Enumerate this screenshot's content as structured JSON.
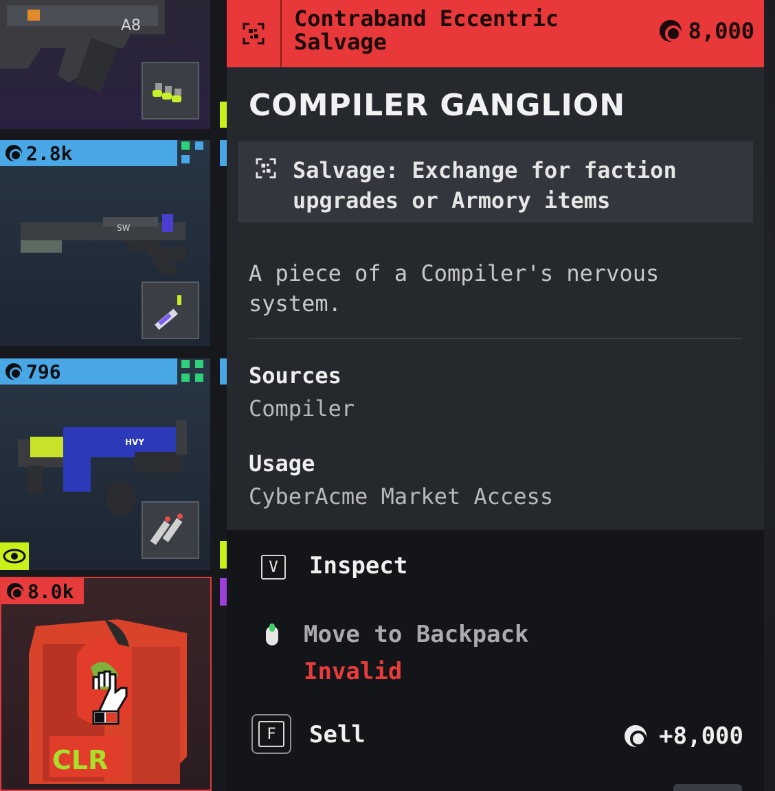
{
  "inventory": {
    "slots": [
      {
        "price": "",
        "accent": "#c9f01a"
      },
      {
        "price": "2.8k",
        "accent": "#49a7e6"
      },
      {
        "price": "796",
        "accent": "#49a7e6"
      },
      {
        "price": "8.0k",
        "accent": "#e83b3b"
      }
    ],
    "gun_labels": {
      "first": "A8",
      "second": "SW",
      "third": "HVY",
      "fourth": "CLR"
    }
  },
  "panel": {
    "header": {
      "category": "Contraband Eccentric Salvage",
      "price": "8,000",
      "color": "#e8383a"
    },
    "item_name": "COMPILER GANGLION",
    "type_line": "Salvage: Exchange for faction upgrades or Armory items",
    "description": "A piece of a Compiler's nervous system.",
    "sources_label": "Sources",
    "sources_value": "Compiler",
    "usage_label": "Usage",
    "usage_value": "CyberAcme Market Access"
  },
  "actions": {
    "inspect": {
      "key": "V",
      "label": "Inspect"
    },
    "move": {
      "label": "Move to Backpack",
      "status": "Invalid"
    },
    "sell": {
      "key": "F",
      "label": "Sell",
      "amount": "+8,000"
    }
  }
}
